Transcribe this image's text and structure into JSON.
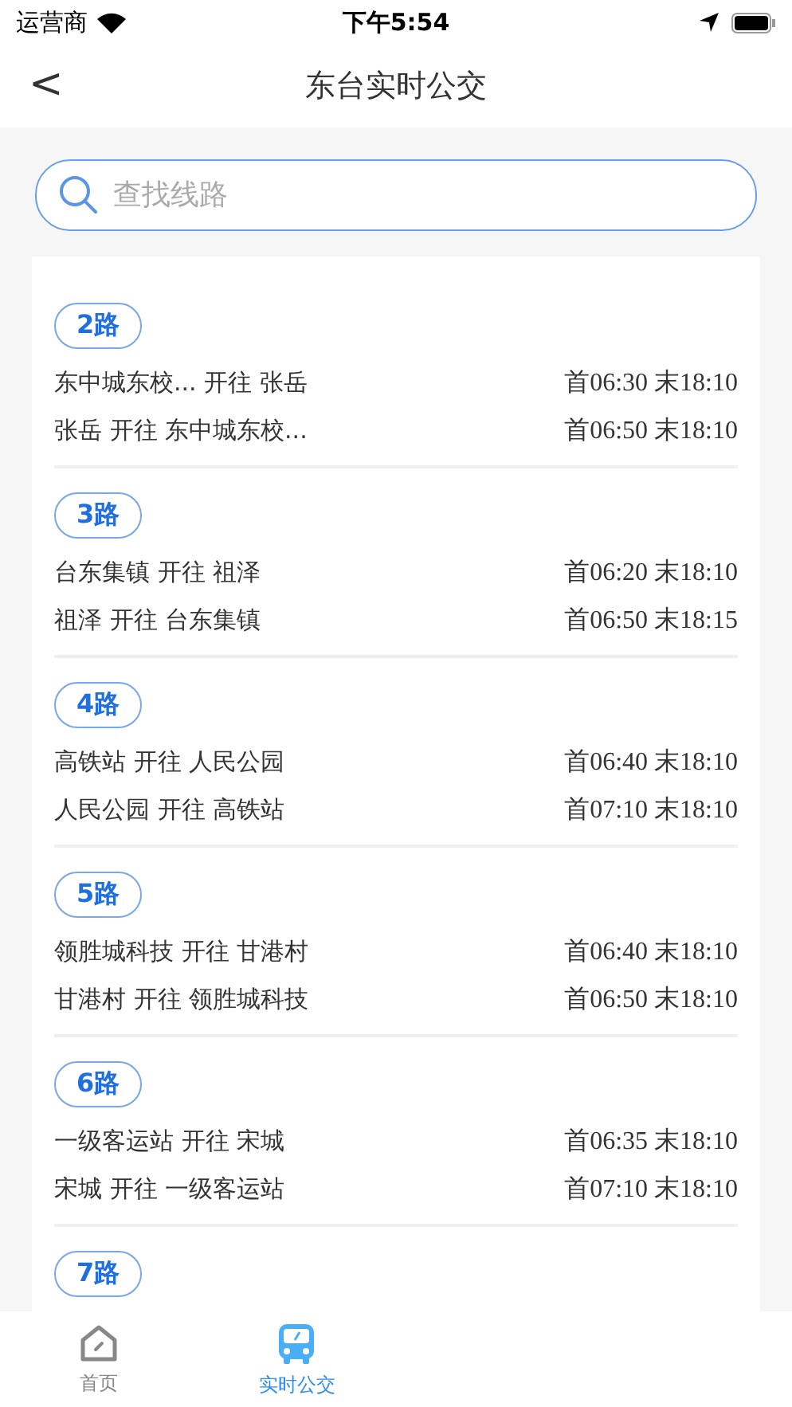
{
  "status_bar": {
    "carrier": "运营商",
    "time": "下午5:54"
  },
  "nav": {
    "back": "<",
    "title": "东台实时公交"
  },
  "search": {
    "placeholder": "查找线路"
  },
  "routes": [
    {
      "name": "2路",
      "trips": [
        {
          "route": "东中城东校... 开往 张岳",
          "times": "首06:30 末18:10"
        },
        {
          "route": "张岳 开往 东中城东校...",
          "times": "首06:50 末18:10"
        }
      ]
    },
    {
      "name": "3路",
      "trips": [
        {
          "route": "台东集镇 开往 祖泽",
          "times": "首06:20 末18:10"
        },
        {
          "route": "祖泽 开往 台东集镇",
          "times": "首06:50 末18:15"
        }
      ]
    },
    {
      "name": "4路",
      "trips": [
        {
          "route": "高铁站 开往 人民公园",
          "times": "首06:40 末18:10"
        },
        {
          "route": "人民公园 开往 高铁站",
          "times": "首07:10 末18:10"
        }
      ]
    },
    {
      "name": "5路",
      "trips": [
        {
          "route": "领胜城科技 开往 甘港村",
          "times": "首06:40 末18:10"
        },
        {
          "route": "甘港村 开往 领胜城科技",
          "times": "首06:50 末18:10"
        }
      ]
    },
    {
      "name": "6路",
      "trips": [
        {
          "route": "一级客运站 开往 宋城",
          "times": "首06:35 末18:10"
        },
        {
          "route": "宋城 开往 一级客运站",
          "times": "首07:10 末18:10"
        }
      ]
    },
    {
      "name": "7路"
    }
  ],
  "tabs": [
    {
      "label": "首页",
      "kind": "home",
      "selected": false
    },
    {
      "label": "实时公交",
      "kind": "bus",
      "selected": true
    }
  ]
}
